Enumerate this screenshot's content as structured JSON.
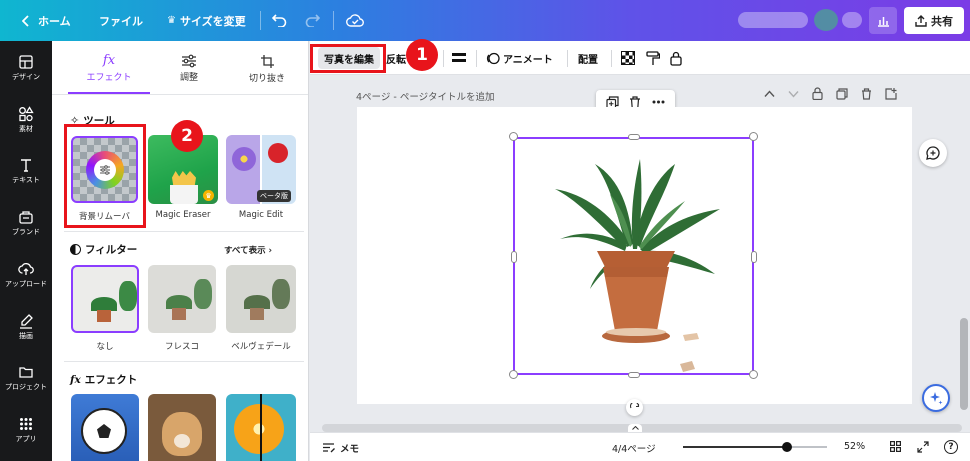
{
  "topbar": {
    "home": "ホーム",
    "file": "ファイル",
    "resize": "サイズを変更",
    "share": "共有"
  },
  "rail": {
    "items": [
      {
        "label": "デザイン",
        "icon": "design-icon"
      },
      {
        "label": "素材",
        "icon": "elements-icon"
      },
      {
        "label": "テキスト",
        "icon": "text-icon"
      },
      {
        "label": "ブランド",
        "icon": "brand-icon"
      },
      {
        "label": "アップロード",
        "icon": "upload-icon"
      },
      {
        "label": "描画",
        "icon": "draw-icon"
      },
      {
        "label": "プロジェクト",
        "icon": "folder-icon"
      },
      {
        "label": "アプリ",
        "icon": "apps-icon"
      }
    ]
  },
  "panel": {
    "tabs": [
      {
        "label": "エフェクト"
      },
      {
        "label": "調整"
      },
      {
        "label": "切り抜き"
      }
    ],
    "tools_title": "ツール",
    "tools": [
      {
        "label": "背景リムーバ"
      },
      {
        "label": "Magic Eraser"
      },
      {
        "label": "Magic Edit",
        "badge": "ベータ版"
      }
    ],
    "filters_title": "フィルター",
    "show_all": "すべて表示",
    "filters": [
      {
        "label": "なし"
      },
      {
        "label": "フレスコ"
      },
      {
        "label": "ベルヴェデール"
      }
    ],
    "effects_title": "エフェクト"
  },
  "toolbar": {
    "edit_photo": "写真を編集",
    "flip": "反転",
    "animate": "アニメート",
    "position": "配置"
  },
  "canvas": {
    "page_label": "4ページ - ",
    "page_title_placeholder": "ページタイトルを追加"
  },
  "bottom": {
    "notes": "メモ",
    "page_count": "4/4ページ",
    "zoom": "52%",
    "zoom_level": 0.52
  },
  "annotations": {
    "badge1": "1",
    "badge2": "2"
  },
  "colors": {
    "accent": "#8b3dff",
    "highlight": "#e8141b",
    "rail_bg": "#18191b"
  }
}
